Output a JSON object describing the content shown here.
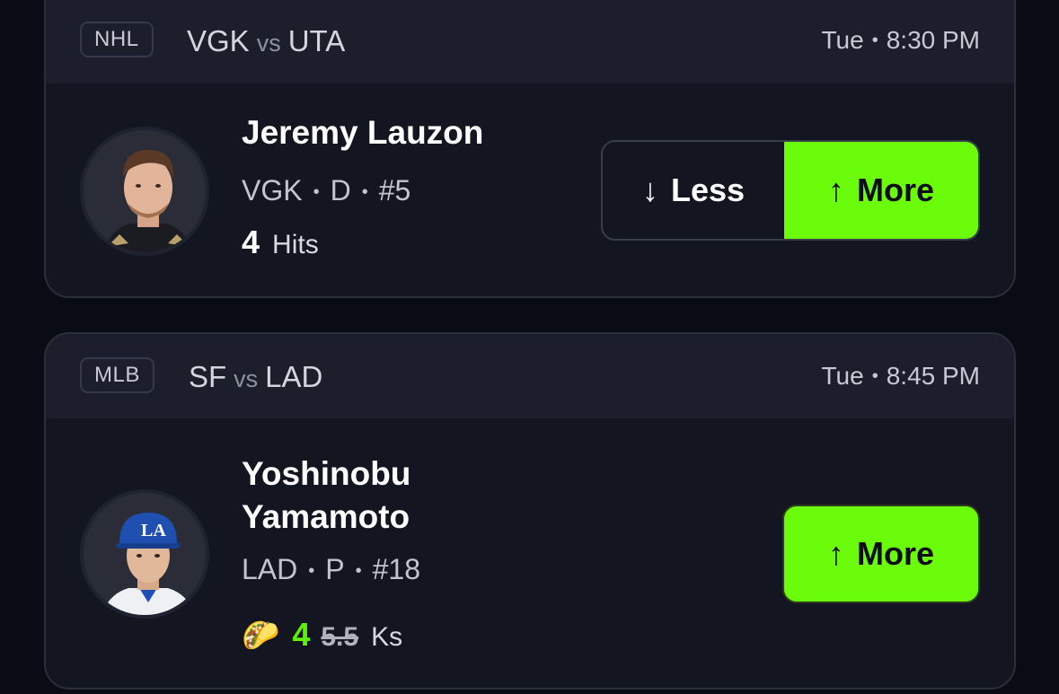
{
  "cards": [
    {
      "league": "NHL",
      "home": "VGK",
      "vs": "vs",
      "away": "UTA",
      "day": "Tue",
      "time": "8:30 PM",
      "player_name": "Jeremy Lauzon",
      "team": "VGK",
      "position": "D",
      "number": "#5",
      "stat_value": "4",
      "stat_label": "Hits",
      "less_label": "Less",
      "more_label": "More"
    },
    {
      "league": "MLB",
      "home": "SF",
      "vs": "vs",
      "away": "LAD",
      "day": "Tue",
      "time": "8:45 PM",
      "player_name_line1": "Yoshinobu",
      "player_name_line2": "Yamamoto",
      "team": "LAD",
      "position": "P",
      "number": "#18",
      "stat_value": "4",
      "stat_old_value": "5.5",
      "stat_label": "Ks",
      "promo_icon": "taco-icon",
      "more_label": "More"
    }
  ],
  "colors": {
    "accent": "#6afc0a",
    "card_bg": "#131520",
    "header_bg": "#1c1f2b",
    "page_bg": "#0a0c14"
  }
}
